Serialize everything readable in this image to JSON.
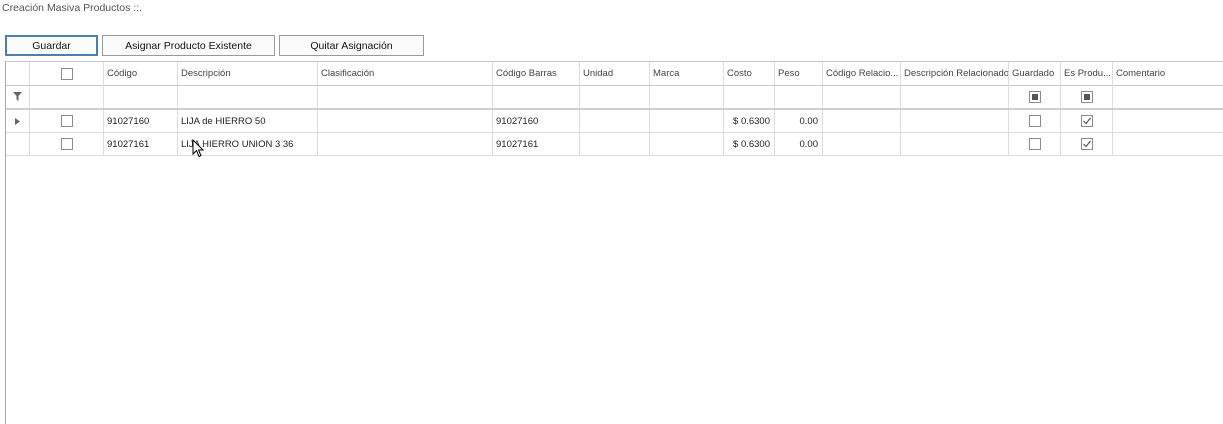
{
  "window": {
    "title": "Creación Masiva Productos  ::."
  },
  "toolbar": {
    "save_label": "Guardar",
    "assign_label": "Asignar Producto Existente",
    "unassign_label": "Quitar Asignación"
  },
  "grid": {
    "columns": [
      "Código",
      "Descripción",
      "Clasificación",
      "Código Barras",
      "Unidad",
      "Marca",
      "Costo",
      "Peso",
      "Código Relacio...",
      "Descripción Relacionado",
      "Guardado",
      "Es Produ...",
      "Comentario"
    ],
    "rows": [
      {
        "codigo": "91027160",
        "descripcion": "LIJA de HIERRO 50",
        "clasificacion": "",
        "codigo_barras": "91027160",
        "unidad": "",
        "marca": "",
        "costo": "$ 0.6300",
        "peso": "0.00",
        "codigo_rel": "",
        "desc_rel": "",
        "guardado": false,
        "es_producto": true,
        "comentario": ""
      },
      {
        "codigo": "91027161",
        "descripcion": "LIJA HIERRO UNION  3 36",
        "clasificacion": "",
        "codigo_barras": "91027161",
        "unidad": "",
        "marca": "",
        "costo": "$ 0.6300",
        "peso": "0.00",
        "codigo_rel": "",
        "desc_rel": "",
        "guardado": false,
        "es_producto": true,
        "comentario": ""
      }
    ]
  },
  "icons": {
    "filter": "filter-icon",
    "row_indicator": "caret-right-icon",
    "cursor": "mouse-pointer-icon"
  },
  "colors": {
    "primary_border": "#4a7fb0",
    "grid_line": "#dcdcdc"
  }
}
